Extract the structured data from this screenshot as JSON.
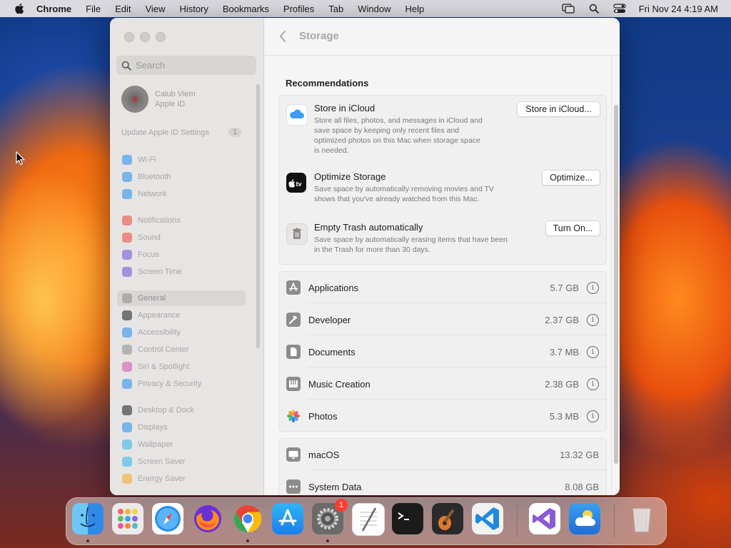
{
  "menubar": {
    "app": "Chrome",
    "items": [
      "File",
      "Edit",
      "View",
      "History",
      "Bookmarks",
      "Profiles",
      "Tab",
      "Window",
      "Help"
    ],
    "clock": "Fri Nov 24  4:19 AM",
    "icons": [
      "apple-icon",
      "screen-mirroring-icon",
      "spotlight-search-icon",
      "control-center-icon"
    ]
  },
  "sidebar": {
    "search_placeholder": "Search",
    "profile_name": "Calub Viem",
    "profile_sub": "Apple ID",
    "update_label": "Update Apple ID Settings",
    "update_badge": "1",
    "items": [
      {
        "label": "Wi-Fi",
        "color": "#1e8ef0"
      },
      {
        "label": "Bluetooth",
        "color": "#1e8ef0"
      },
      {
        "label": "Network",
        "color": "#1e8ef0"
      },
      {
        "label": "Notifications",
        "color": "#f0443a"
      },
      {
        "label": "Sound",
        "color": "#f0443a"
      },
      {
        "label": "Focus",
        "color": "#6a4fd8"
      },
      {
        "label": "Screen Time",
        "color": "#6a4fd8"
      },
      {
        "label": "General",
        "color": "#8a8a8a"
      },
      {
        "label": "Appearance",
        "color": "#1a1a1a"
      },
      {
        "label": "Accessibility",
        "color": "#1e8ef0"
      },
      {
        "label": "Control Center",
        "color": "#8a8a8a"
      },
      {
        "label": "Siri & Spotlight",
        "color": "#d04fb0"
      },
      {
        "label": "Privacy & Security",
        "color": "#1e8ef0"
      },
      {
        "label": "Desktop & Dock",
        "color": "#1a1a1a"
      },
      {
        "label": "Displays",
        "color": "#1e8ef0"
      },
      {
        "label": "Wallpaper",
        "color": "#2bb4e6"
      },
      {
        "label": "Screen Saver",
        "color": "#2bb4e6"
      },
      {
        "label": "Energy Saver",
        "color": "#f5a623"
      }
    ],
    "active": "General"
  },
  "content": {
    "title": "Storage",
    "recommendations_heading": "Recommendations",
    "recommendations": [
      {
        "title": "Store in iCloud",
        "desc_lines": [
          "Store all files, photos, and messages in iCloud and",
          "save space by keeping only recent files and",
          "optimized photos on this Mac when storage space",
          "is needed."
        ],
        "button": "Store in iCloud...",
        "icon": "icloud-icon"
      },
      {
        "title": "Optimize Storage",
        "desc_lines": [
          "Save space by automatically removing movies and TV",
          "shows that you've already watched from this Mac."
        ],
        "button": "Optimize...",
        "icon": "apple-tv-icon"
      },
      {
        "title": "Empty Trash automatically",
        "desc_lines": [
          "Save space by automatically erasing items that have been",
          "in the Trash for more than 30 days."
        ],
        "button": "Turn On...",
        "icon": "trash-icon"
      }
    ],
    "categories": [
      {
        "name": "Applications",
        "size": "5.7 GB",
        "icon": "applications-icon"
      },
      {
        "name": "Developer",
        "size": "2.37 GB",
        "icon": "hammer-icon"
      },
      {
        "name": "Documents",
        "size": "3.7 MB",
        "icon": "document-icon"
      },
      {
        "name": "Music Creation",
        "size": "2.38 GB",
        "icon": "music-creation-icon"
      },
      {
        "name": "Photos",
        "size": "5.3 MB",
        "icon": "photos-icon"
      }
    ],
    "system": [
      {
        "name": "macOS",
        "size": "13.32 GB",
        "icon": "display-icon"
      },
      {
        "name": "System Data",
        "size": "8.08 GB",
        "icon": "ellipsis-icon"
      }
    ]
  },
  "dock": {
    "apps": [
      "Finder",
      "Launchpad",
      "Safari",
      "Firefox",
      "Google Chrome",
      "App Store",
      "System Settings",
      "TextEdit",
      "Terminal",
      "GarageBand",
      "Visual Studio Code",
      "Visual Studio",
      "Weather",
      "Trash"
    ],
    "settings_badge": "1"
  }
}
